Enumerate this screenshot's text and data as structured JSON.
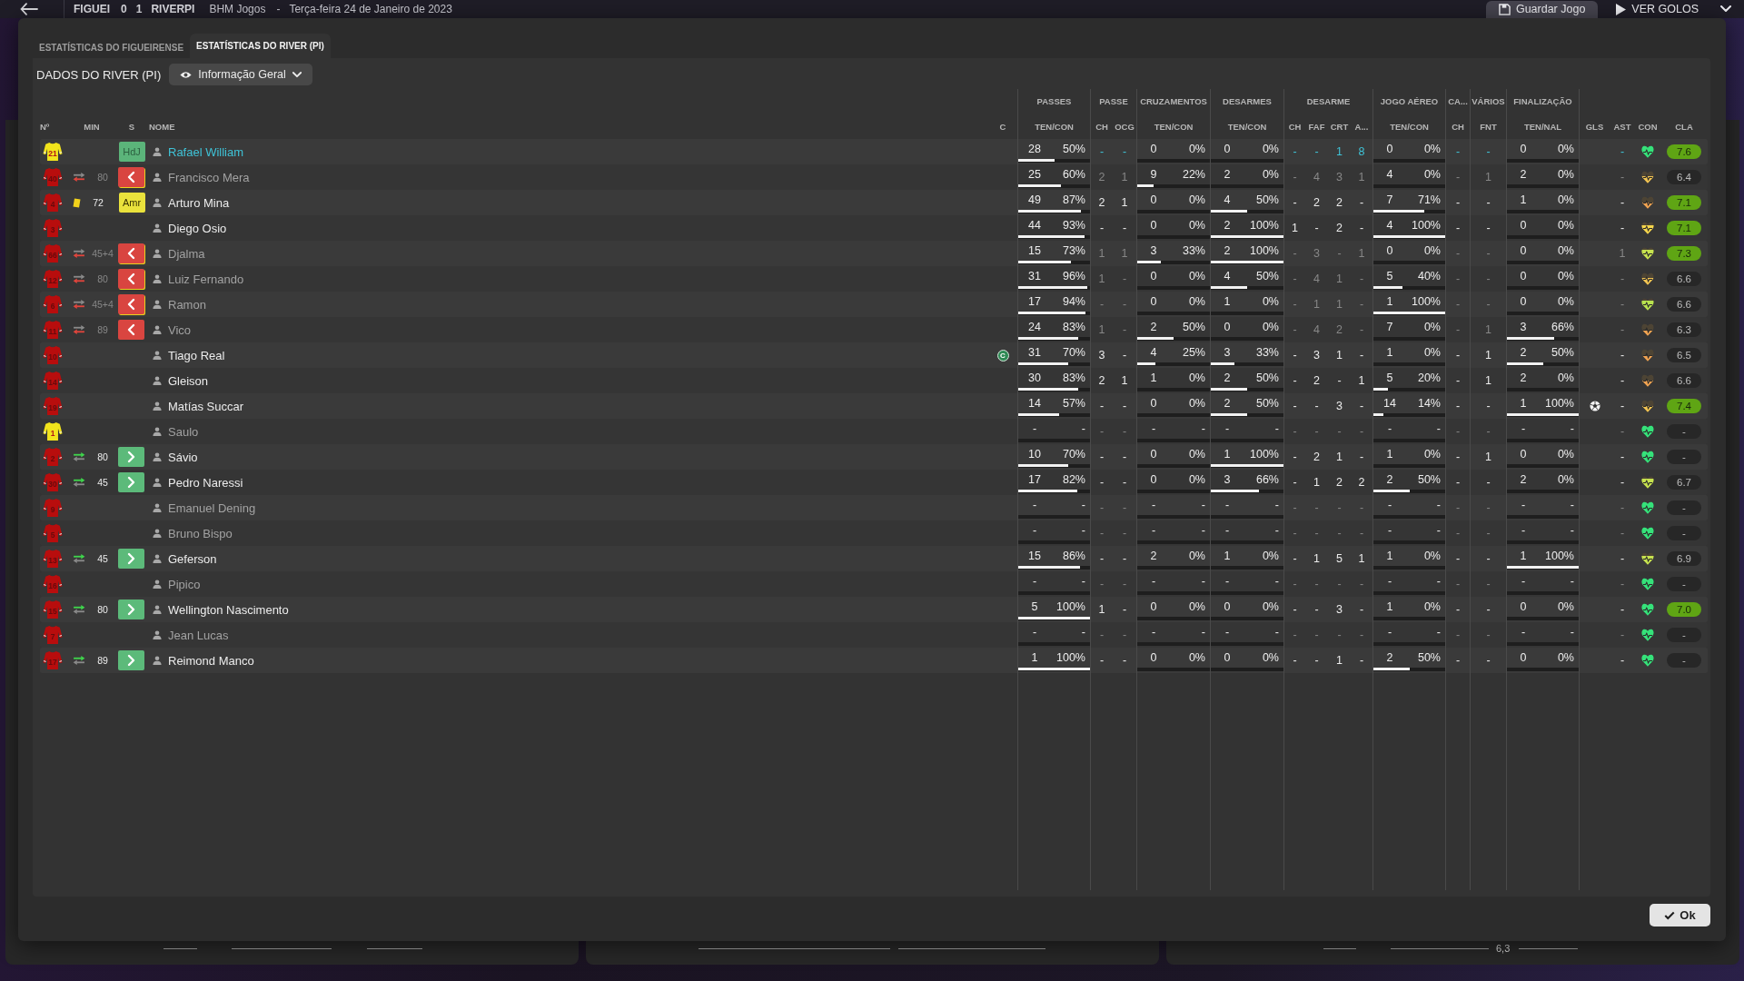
{
  "top_bar": {
    "home_team": "FIGUEI",
    "score": [
      "0",
      "1"
    ],
    "away_team": "RIVERPI",
    "competition": "BHM Jogos",
    "separator": "-",
    "date": "Terça-feira 24 de Janeiro de 2023",
    "buttons": [
      {
        "kind": "save",
        "label": "Guardar Jogo"
      },
      {
        "kind": "play",
        "label": "VER GOLOS"
      }
    ]
  },
  "background": {
    "scale_label": "6,3"
  },
  "dialog": {
    "tabs": [
      {
        "label": "ESTATÍSTICAS DO FIGUEIRENSE",
        "selected": false
      },
      {
        "label": "ESTATÍSTICAS DO RIVER (PI)",
        "selected": true
      }
    ],
    "title": "DADOS DO RIVER (PI)",
    "view_menu": {
      "label": "Informação Geral"
    },
    "table": {
      "columns": [
        {
          "label": "Nº",
          "kind": "number"
        },
        {
          "label": "MIN",
          "kind": "minute"
        },
        {
          "label": "S",
          "kind": "status"
        },
        {
          "label": "NOME",
          "kind": "name"
        },
        {
          "label": "C",
          "kind": "captain"
        },
        {
          "kind": "group",
          "label": "PASSES",
          "columns": [
            {
              "label": "TEN/CON",
              "kind": "pair"
            }
          ]
        },
        {
          "kind": "group",
          "label": "PASSE",
          "columns": [
            {
              "label": "CH",
              "kind": "value"
            },
            {
              "label": "OCG",
              "kind": "value"
            }
          ]
        },
        {
          "kind": "group",
          "label": "CRUZAMENTOS",
          "columns": [
            {
              "label": "TEN/CON",
              "kind": "pair"
            }
          ]
        },
        {
          "kind": "group",
          "label": "DESARMES",
          "columns": [
            {
              "label": "TEN/CON",
              "kind": "pair"
            }
          ]
        },
        {
          "kind": "group",
          "label": "DESARME",
          "columns": [
            {
              "label": "CH",
              "kind": "value"
            },
            {
              "label": "FAF",
              "kind": "value"
            },
            {
              "label": "CRT",
              "kind": "value"
            },
            {
              "label": "A...",
              "kind": "value"
            }
          ]
        },
        {
          "kind": "group",
          "label": "JOGO AÉREO",
          "columns": [
            {
              "label": "TEN/CON",
              "kind": "pair"
            }
          ]
        },
        {
          "kind": "group",
          "label": "CA...",
          "columns": [
            {
              "label": "CH",
              "kind": "value"
            }
          ]
        },
        {
          "kind": "group",
          "label": "VÁRIOS",
          "columns": [
            {
              "label": "FNT",
              "kind": "value"
            }
          ]
        },
        {
          "kind": "group",
          "label": "FINALIZAÇÃO",
          "columns": [
            {
              "label": "TEN/NAL",
              "kind": "pair"
            }
          ]
        },
        {
          "label": "GLS",
          "kind": "goal"
        },
        {
          "label": "AST",
          "kind": "value"
        },
        {
          "label": "CON",
          "kind": "condition"
        },
        {
          "label": "CLA",
          "kind": "rating"
        }
      ],
      "rows": [
        {
          "highlighted": true,
          "faded": false,
          "cells": [
            {
              "number": "21",
              "color": "#f2e41c"
            },
            "",
            {
              "kind": "label",
              "text": "HdJ",
              "color": "#5bb47a"
            },
            "Rafael William",
            "",
            [
              {
                "count": "28",
                "pct": "50%",
                "level": 0.5
              }
            ],
            [
              "-",
              "-"
            ],
            [
              {
                "count": "0",
                "pct": "0%",
                "level": 0
              }
            ],
            [
              {
                "count": "0",
                "pct": "0%",
                "level": 0
              }
            ],
            [
              "-",
              "-",
              "1",
              "8"
            ],
            [
              {
                "count": "0",
                "pct": "0%",
                "level": 0
              }
            ],
            [
              "-"
            ],
            [
              "-"
            ],
            [
              {
                "count": "0",
                "pct": "0%",
                "level": 0
              }
            ],
            {
              "scored": false
            },
            "-",
            {
              "level": 1,
              "color": "#35e27a"
            },
            {
              "value": "7.6",
              "good": true
            }
          ]
        },
        {
          "highlighted": false,
          "faded": true,
          "cells": [
            {
              "number": "40",
              "color": "#b80d0d"
            },
            {
              "kind": "sub_off",
              "minute": "80"
            },
            {
              "kind": "off",
              "color": "#d94540",
              "booked": true
            },
            "Francisco Mera",
            "",
            [
              {
                "count": "25",
                "pct": "60%",
                "level": 0.6
              }
            ],
            [
              "2",
              "1"
            ],
            [
              {
                "count": "9",
                "pct": "22%",
                "level": 0.22
              }
            ],
            [
              {
                "count": "2",
                "pct": "0%",
                "level": 0
              }
            ],
            [
              "-",
              "4",
              "3",
              "1"
            ],
            [
              {
                "count": "4",
                "pct": "0%",
                "level": 0
              }
            ],
            [
              "-"
            ],
            [
              "1"
            ],
            [
              {
                "count": "2",
                "pct": "0%",
                "level": 0
              }
            ],
            {
              "scored": false
            },
            "-",
            {
              "level": 0.6,
              "color": "#f2c452"
            },
            {
              "value": "6.4",
              "good": false
            }
          ]
        },
        {
          "highlighted": false,
          "faded": false,
          "cells": [
            {
              "number": "4",
              "color": "#b80d0d"
            },
            {
              "kind": "yellow_card",
              "minute": "72"
            },
            {
              "kind": "label",
              "text": "Amr",
              "color": "#eae23c"
            },
            "Arturo Mina",
            "",
            [
              {
                "count": "49",
                "pct": "87%",
                "level": 0.87
              }
            ],
            [
              "2",
              "1"
            ],
            [
              {
                "count": "0",
                "pct": "0%",
                "level": 0
              }
            ],
            [
              {
                "count": "4",
                "pct": "50%",
                "level": 0.5
              }
            ],
            [
              "-",
              "2",
              "2",
              "-"
            ],
            [
              {
                "count": "7",
                "pct": "71%",
                "level": 0.71
              }
            ],
            [
              "-"
            ],
            [
              "-"
            ],
            [
              {
                "count": "1",
                "pct": "0%",
                "level": 0
              }
            ],
            {
              "scored": false
            },
            "-",
            {
              "level": 0.5,
              "color": "#f0a352"
            },
            {
              "value": "7.1",
              "good": true
            }
          ]
        },
        {
          "highlighted": false,
          "faded": false,
          "cells": [
            {
              "number": "3",
              "color": "#b80d0d"
            },
            "",
            "",
            "Diego Osio",
            "",
            [
              {
                "count": "44",
                "pct": "93%",
                "level": 0.93
              }
            ],
            [
              "-",
              "-"
            ],
            [
              {
                "count": "0",
                "pct": "0%",
                "level": 0
              }
            ],
            [
              {
                "count": "2",
                "pct": "100%",
                "level": 1
              }
            ],
            [
              "1",
              "-",
              "2",
              "-"
            ],
            [
              {
                "count": "4",
                "pct": "100%",
                "level": 1
              }
            ],
            [
              "-"
            ],
            [
              "-"
            ],
            [
              {
                "count": "0",
                "pct": "0%",
                "level": 0
              }
            ],
            {
              "scored": false
            },
            "-",
            {
              "level": 0.7,
              "color": "#f5d54c"
            },
            {
              "value": "7.1",
              "good": true
            }
          ]
        },
        {
          "highlighted": false,
          "faded": true,
          "cells": [
            {
              "number": "66",
              "color": "#b80d0d"
            },
            {
              "kind": "sub_off",
              "minute": "45+4"
            },
            {
              "kind": "off",
              "color": "#d94540",
              "booked": true
            },
            "Djalma",
            "",
            [
              {
                "count": "15",
                "pct": "73%",
                "level": 0.73
              }
            ],
            [
              "1",
              "1"
            ],
            [
              {
                "count": "3",
                "pct": "33%",
                "level": 0.33
              }
            ],
            [
              {
                "count": "2",
                "pct": "100%",
                "level": 1
              }
            ],
            [
              "-",
              "3",
              "-",
              "1"
            ],
            [
              {
                "count": "0",
                "pct": "0%",
                "level": 0
              }
            ],
            [
              "-"
            ],
            [
              "-"
            ],
            [
              {
                "count": "0",
                "pct": "0%",
                "level": 0
              }
            ],
            {
              "scored": false
            },
            "1",
            {
              "level": 0.75,
              "color": "#c6e24f"
            },
            {
              "value": "7.3",
              "good": true
            }
          ]
        },
        {
          "highlighted": false,
          "faded": true,
          "cells": [
            {
              "number": "12",
              "color": "#b80d0d"
            },
            {
              "kind": "sub_off",
              "minute": "80"
            },
            {
              "kind": "off",
              "color": "#d94540",
              "booked": true
            },
            "Luiz Fernando",
            "",
            [
              {
                "count": "31",
                "pct": "96%",
                "level": 0.96
              }
            ],
            [
              "1",
              "-"
            ],
            [
              {
                "count": "0",
                "pct": "0%",
                "level": 0
              }
            ],
            [
              {
                "count": "4",
                "pct": "50%",
                "level": 0.5
              }
            ],
            [
              "-",
              "4",
              "1",
              "-"
            ],
            [
              {
                "count": "5",
                "pct": "40%",
                "level": 0.4
              }
            ],
            [
              "-"
            ],
            [
              "-"
            ],
            [
              {
                "count": "0",
                "pct": "0%",
                "level": 0
              }
            ],
            {
              "scored": false
            },
            "-",
            {
              "level": 0.55,
              "color": "#f2c452"
            },
            {
              "value": "6.6",
              "good": false
            }
          ]
        },
        {
          "highlighted": false,
          "faded": true,
          "cells": [
            {
              "number": "6",
              "color": "#b80d0d"
            },
            {
              "kind": "sub_off",
              "minute": "45+4"
            },
            {
              "kind": "off",
              "color": "#d94540",
              "booked": true
            },
            "Ramon",
            "",
            [
              {
                "count": "17",
                "pct": "94%",
                "level": 0.94
              }
            ],
            [
              "-",
              "-"
            ],
            [
              {
                "count": "0",
                "pct": "0%",
                "level": 0
              }
            ],
            [
              {
                "count": "1",
                "pct": "0%",
                "level": 0
              }
            ],
            [
              "-",
              "1",
              "1",
              "-"
            ],
            [
              {
                "count": "1",
                "pct": "100%",
                "level": 1
              }
            ],
            [
              "-"
            ],
            [
              "-"
            ],
            [
              {
                "count": "0",
                "pct": "0%",
                "level": 0
              }
            ],
            {
              "scored": false
            },
            "-",
            {
              "level": 0.8,
              "color": "#b8e24f"
            },
            {
              "value": "6.6",
              "good": false
            }
          ]
        },
        {
          "highlighted": false,
          "faded": true,
          "cells": [
            {
              "number": "11",
              "color": "#b80d0d"
            },
            {
              "kind": "sub_off",
              "minute": "89"
            },
            {
              "kind": "off",
              "color": "#d94540",
              "booked": false
            },
            "Vico",
            "",
            [
              {
                "count": "24",
                "pct": "83%",
                "level": 0.83
              }
            ],
            [
              "1",
              "-"
            ],
            [
              {
                "count": "2",
                "pct": "50%",
                "level": 0.5
              }
            ],
            [
              {
                "count": "0",
                "pct": "0%",
                "level": 0
              }
            ],
            [
              "-",
              "4",
              "2",
              "-"
            ],
            [
              {
                "count": "7",
                "pct": "0%",
                "level": 0
              }
            ],
            [
              "-"
            ],
            [
              "1"
            ],
            [
              {
                "count": "3",
                "pct": "66%",
                "level": 0.66
              }
            ],
            {
              "scored": false
            },
            "-",
            {
              "level": 0.45,
              "color": "#f0a352"
            },
            {
              "value": "6.3",
              "good": false
            }
          ]
        },
        {
          "highlighted": false,
          "faded": false,
          "cells": [
            {
              "number": "10",
              "color": "#b80d0d"
            },
            "",
            "",
            "Tiago Real",
            "C",
            [
              {
                "count": "31",
                "pct": "70%",
                "level": 0.7
              }
            ],
            [
              "3",
              "-"
            ],
            [
              {
                "count": "4",
                "pct": "25%",
                "level": 0.25
              }
            ],
            [
              {
                "count": "3",
                "pct": "33%",
                "level": 0.33
              }
            ],
            [
              "-",
              "3",
              "1",
              "-"
            ],
            [
              {
                "count": "1",
                "pct": "0%",
                "level": 0
              }
            ],
            [
              "-"
            ],
            [
              "1"
            ],
            [
              {
                "count": "2",
                "pct": "50%",
                "level": 0.5
              }
            ],
            {
              "scored": false
            },
            "-",
            {
              "level": 0.45,
              "color": "#f0a352"
            },
            {
              "value": "6.5",
              "good": false
            }
          ]
        },
        {
          "highlighted": false,
          "faded": false,
          "cells": [
            {
              "number": "14",
              "color": "#b80d0d"
            },
            "",
            "",
            "Gleison",
            "",
            [
              {
                "count": "30",
                "pct": "83%",
                "level": 0.83
              }
            ],
            [
              "2",
              "1"
            ],
            [
              {
                "count": "1",
                "pct": "0%",
                "level": 0
              }
            ],
            [
              {
                "count": "2",
                "pct": "50%",
                "level": 0.5
              }
            ],
            [
              "-",
              "2",
              "-",
              "1"
            ],
            [
              {
                "count": "5",
                "pct": "20%",
                "level": 0.2
              }
            ],
            [
              "-"
            ],
            [
              "1"
            ],
            [
              {
                "count": "2",
                "pct": "0%",
                "level": 0
              }
            ],
            {
              "scored": false
            },
            "-",
            {
              "level": 0.5,
              "color": "#f0a352"
            },
            {
              "value": "6.6",
              "good": false
            }
          ]
        },
        {
          "highlighted": false,
          "faded": false,
          "cells": [
            {
              "number": "19",
              "color": "#b80d0d"
            },
            "",
            "",
            "Matías Succar",
            "",
            [
              {
                "count": "14",
                "pct": "57%",
                "level": 0.57
              }
            ],
            [
              "-",
              "-"
            ],
            [
              {
                "count": "0",
                "pct": "0%",
                "level": 0
              }
            ],
            [
              {
                "count": "2",
                "pct": "50%",
                "level": 0.5
              }
            ],
            [
              "-",
              "-",
              "3",
              "-"
            ],
            [
              {
                "count": "14",
                "pct": "14%",
                "level": 0.14
              }
            ],
            [
              "-"
            ],
            [
              "-"
            ],
            [
              {
                "count": "1",
                "pct": "100%",
                "level": 1
              }
            ],
            {
              "scored": true
            },
            "-",
            {
              "level": 0.5,
              "color": "#f2c452"
            },
            {
              "value": "7.4",
              "good": true
            }
          ]
        },
        {
          "highlighted": false,
          "faded": true,
          "cells": [
            {
              "number": "1",
              "color": "#f2e41c"
            },
            "",
            "",
            "Saulo",
            "",
            [
              {
                "count": "-",
                "pct": "-",
                "level": 0
              }
            ],
            [
              "-",
              "-"
            ],
            [
              {
                "count": "-",
                "pct": "-",
                "level": 0
              }
            ],
            [
              {
                "count": "-",
                "pct": "-",
                "level": 0
              }
            ],
            [
              "-",
              "-",
              "-",
              "-"
            ],
            [
              {
                "count": "-",
                "pct": "-",
                "level": 0
              }
            ],
            [
              "-"
            ],
            [
              "-"
            ],
            [
              {
                "count": "-",
                "pct": "-",
                "level": 0
              }
            ],
            {
              "scored": false
            },
            "-",
            {
              "level": 1,
              "color": "#35e27a"
            },
            {
              "value": "-",
              "good": false
            }
          ]
        },
        {
          "highlighted": false,
          "faded": false,
          "cells": [
            {
              "number": "2",
              "color": "#b80d0d"
            },
            {
              "kind": "sub_on",
              "minute": "80"
            },
            {
              "kind": "on",
              "color": "#5cba7a",
              "booked": false
            },
            "Sávio",
            "",
            [
              {
                "count": "10",
                "pct": "70%",
                "level": 0.7
              }
            ],
            [
              "-",
              "-"
            ],
            [
              {
                "count": "0",
                "pct": "0%",
                "level": 0
              }
            ],
            [
              {
                "count": "1",
                "pct": "100%",
                "level": 1
              }
            ],
            [
              "-",
              "2",
              "1",
              "-"
            ],
            [
              {
                "count": "1",
                "pct": "0%",
                "level": 0
              }
            ],
            [
              "-"
            ],
            [
              "1"
            ],
            [
              {
                "count": "0",
                "pct": "0%",
                "level": 0
              }
            ],
            {
              "scored": false
            },
            "-",
            {
              "level": 1,
              "color": "#35e27a"
            },
            {
              "value": "-",
              "good": false
            }
          ]
        },
        {
          "highlighted": false,
          "faded": false,
          "cells": [
            {
              "number": "30",
              "color": "#b80d0d"
            },
            {
              "kind": "sub_on",
              "minute": "45"
            },
            {
              "kind": "on",
              "color": "#5cba7a",
              "booked": false
            },
            "Pedro Naressi",
            "",
            [
              {
                "count": "17",
                "pct": "82%",
                "level": 0.82
              }
            ],
            [
              "-",
              "-"
            ],
            [
              {
                "count": "0",
                "pct": "0%",
                "level": 0
              }
            ],
            [
              {
                "count": "3",
                "pct": "66%",
                "level": 0.66
              }
            ],
            [
              "-",
              "1",
              "2",
              "2"
            ],
            [
              {
                "count": "2",
                "pct": "50%",
                "level": 0.5
              }
            ],
            [
              "-"
            ],
            [
              "-"
            ],
            [
              {
                "count": "2",
                "pct": "0%",
                "level": 0
              }
            ],
            {
              "scored": false
            },
            "-",
            {
              "level": 0.75,
              "color": "#c6e24f"
            },
            {
              "value": "6.7",
              "good": false
            }
          ]
        },
        {
          "highlighted": false,
          "faded": true,
          "cells": [
            {
              "number": "9",
              "color": "#b80d0d"
            },
            "",
            "",
            "Emanuel Dening",
            "",
            [
              {
                "count": "-",
                "pct": "-",
                "level": 0
              }
            ],
            [
              "-",
              "-"
            ],
            [
              {
                "count": "-",
                "pct": "-",
                "level": 0
              }
            ],
            [
              {
                "count": "-",
                "pct": "-",
                "level": 0
              }
            ],
            [
              "-",
              "-",
              "-",
              "-"
            ],
            [
              {
                "count": "-",
                "pct": "-",
                "level": 0
              }
            ],
            [
              "-"
            ],
            [
              "-"
            ],
            [
              {
                "count": "-",
                "pct": "-",
                "level": 0
              }
            ],
            {
              "scored": false
            },
            "-",
            {
              "level": 1,
              "color": "#35e27a"
            },
            {
              "value": "-",
              "good": false
            }
          ]
        },
        {
          "highlighted": false,
          "faded": true,
          "cells": [
            {
              "number": "5",
              "color": "#b80d0d"
            },
            "",
            "",
            "Bruno Bispo",
            "",
            [
              {
                "count": "-",
                "pct": "-",
                "level": 0
              }
            ],
            [
              "-",
              "-"
            ],
            [
              {
                "count": "-",
                "pct": "-",
                "level": 0
              }
            ],
            [
              {
                "count": "-",
                "pct": "-",
                "level": 0
              }
            ],
            [
              "-",
              "-",
              "-",
              "-"
            ],
            [
              {
                "count": "-",
                "pct": "-",
                "level": 0
              }
            ],
            [
              "-"
            ],
            [
              "-"
            ],
            [
              {
                "count": "-",
                "pct": "-",
                "level": 0
              }
            ],
            {
              "scored": false
            },
            "-",
            {
              "level": 1,
              "color": "#35e27a"
            },
            {
              "value": "-",
              "good": false
            }
          ]
        },
        {
          "highlighted": false,
          "faded": false,
          "cells": [
            {
              "number": "13",
              "color": "#b80d0d"
            },
            {
              "kind": "sub_on",
              "minute": "45"
            },
            {
              "kind": "on",
              "color": "#5cba7a",
              "booked": false
            },
            "Geferson",
            "",
            [
              {
                "count": "15",
                "pct": "86%",
                "level": 0.86
              }
            ],
            [
              "-",
              "-"
            ],
            [
              {
                "count": "2",
                "pct": "0%",
                "level": 0
              }
            ],
            [
              {
                "count": "1",
                "pct": "0%",
                "level": 0
              }
            ],
            [
              "-",
              "1",
              "5",
              "1"
            ],
            [
              {
                "count": "1",
                "pct": "0%",
                "level": 0
              }
            ],
            [
              "-"
            ],
            [
              "-"
            ],
            [
              {
                "count": "1",
                "pct": "100%",
                "level": 1
              }
            ],
            {
              "scored": false
            },
            "-",
            {
              "level": 0.7,
              "color": "#c6e24f"
            },
            {
              "value": "6.9",
              "good": false
            }
          ]
        },
        {
          "highlighted": false,
          "faded": true,
          "cells": [
            {
              "number": "16",
              "color": "#b80d0d"
            },
            "",
            "",
            "Pipico",
            "",
            [
              {
                "count": "-",
                "pct": "-",
                "level": 0
              }
            ],
            [
              "-",
              "-"
            ],
            [
              {
                "count": "-",
                "pct": "-",
                "level": 0
              }
            ],
            [
              {
                "count": "-",
                "pct": "-",
                "level": 0
              }
            ],
            [
              "-",
              "-",
              "-",
              "-"
            ],
            [
              {
                "count": "-",
                "pct": "-",
                "level": 0
              }
            ],
            [
              "-"
            ],
            [
              "-"
            ],
            [
              {
                "count": "-",
                "pct": "-",
                "level": 0
              }
            ],
            {
              "scored": false
            },
            "-",
            {
              "level": 1,
              "color": "#35e27a"
            },
            {
              "value": "-",
              "good": false
            }
          ]
        },
        {
          "highlighted": false,
          "faded": false,
          "cells": [
            {
              "number": "15",
              "color": "#b80d0d"
            },
            {
              "kind": "sub_on",
              "minute": "80"
            },
            {
              "kind": "on",
              "color": "#5cba7a",
              "booked": false
            },
            "Wellington Nascimento",
            "",
            [
              {
                "count": "5",
                "pct": "100%",
                "level": 1
              }
            ],
            [
              "1",
              "-"
            ],
            [
              {
                "count": "0",
                "pct": "0%",
                "level": 0
              }
            ],
            [
              {
                "count": "0",
                "pct": "0%",
                "level": 0
              }
            ],
            [
              "-",
              "-",
              "3",
              "-"
            ],
            [
              {
                "count": "1",
                "pct": "0%",
                "level": 0
              }
            ],
            [
              "-"
            ],
            [
              "-"
            ],
            [
              {
                "count": "0",
                "pct": "0%",
                "level": 0
              }
            ],
            {
              "scored": false
            },
            "-",
            {
              "level": 1,
              "color": "#35e27a"
            },
            {
              "value": "7.0",
              "good": true
            }
          ]
        },
        {
          "highlighted": false,
          "faded": true,
          "cells": [
            {
              "number": "7",
              "color": "#b80d0d"
            },
            "",
            "",
            "Jean Lucas",
            "",
            [
              {
                "count": "-",
                "pct": "-",
                "level": 0
              }
            ],
            [
              "-",
              "-"
            ],
            [
              {
                "count": "-",
                "pct": "-",
                "level": 0
              }
            ],
            [
              {
                "count": "-",
                "pct": "-",
                "level": 0
              }
            ],
            [
              "-",
              "-",
              "-",
              "-"
            ],
            [
              {
                "count": "-",
                "pct": "-",
                "level": 0
              }
            ],
            [
              "-"
            ],
            [
              "-"
            ],
            [
              {
                "count": "-",
                "pct": "-",
                "level": 0
              }
            ],
            {
              "scored": false
            },
            "-",
            {
              "level": 1,
              "color": "#35e27a"
            },
            {
              "value": "-",
              "good": false
            }
          ]
        },
        {
          "highlighted": false,
          "faded": false,
          "cells": [
            {
              "number": "17",
              "color": "#b80d0d"
            },
            {
              "kind": "sub_on",
              "minute": "89"
            },
            {
              "kind": "on",
              "color": "#5cba7a",
              "booked": false
            },
            "Reimond Manco",
            "",
            [
              {
                "count": "1",
                "pct": "100%",
                "level": 1
              }
            ],
            [
              "-",
              "-"
            ],
            [
              {
                "count": "0",
                "pct": "0%",
                "level": 0
              }
            ],
            [
              {
                "count": "0",
                "pct": "0%",
                "level": 0
              }
            ],
            [
              "-",
              "-",
              "1",
              "-"
            ],
            [
              {
                "count": "2",
                "pct": "50%",
                "level": 0.5
              }
            ],
            [
              "-"
            ],
            [
              "-"
            ],
            [
              {
                "count": "0",
                "pct": "0%",
                "level": 0
              }
            ],
            {
              "scored": false
            },
            "-",
            {
              "level": 1,
              "color": "#35e27a"
            },
            {
              "value": "-",
              "good": false
            }
          ]
        }
      ]
    },
    "ok_button": {
      "label": "Ok"
    }
  }
}
